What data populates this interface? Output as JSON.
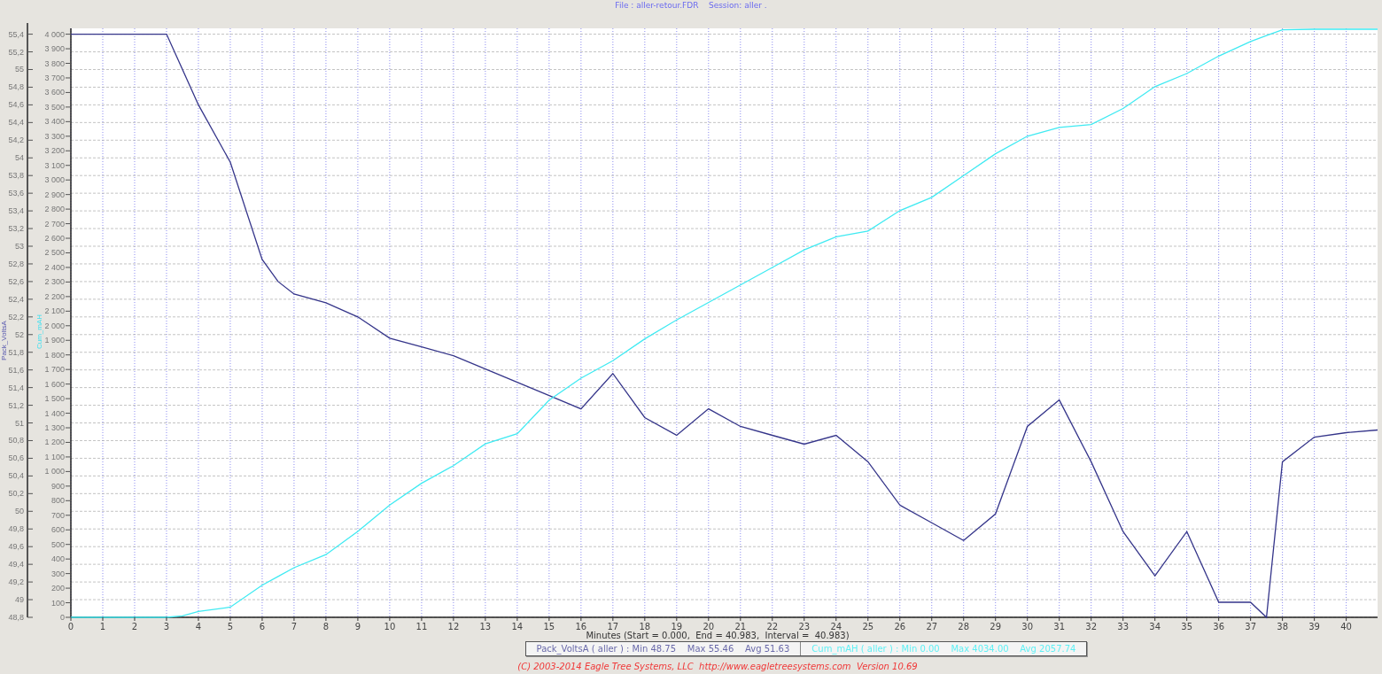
{
  "window": {
    "title": "File : aller-retour.FDR    Session: aller ."
  },
  "chart": {
    "chart_data": {
      "type": "line",
      "xlabel": "Minutes (Start = 0.000,  End = 40.983,  Interval =  40.983)",
      "ylabel": "Pack_VoltsA",
      "y2label": "Cum_mAH",
      "x": [
        0,
        1,
        2,
        3,
        3.5,
        4,
        5,
        6,
        6.5,
        7,
        8,
        9,
        10,
        11,
        12,
        13,
        14,
        15,
        16,
        17,
        18,
        19,
        20,
        21,
        22,
        23,
        24,
        25,
        26,
        27,
        28,
        29,
        30,
        31,
        32,
        33,
        34,
        35,
        36,
        37,
        37.5,
        38,
        39,
        40,
        40.983
      ],
      "series": [
        {
          "name": "Pack_VoltsA ( aller )",
          "color": "#35358a",
          "values": [
            55.4,
            55.4,
            55.4,
            55.4,
            55.0,
            54.6,
            53.95,
            52.85,
            52.6,
            52.46,
            52.36,
            52.2,
            51.96,
            51.86,
            51.76,
            51.61,
            51.46,
            51.31,
            51.16,
            51.56,
            51.06,
            50.86,
            51.16,
            50.96,
            50.86,
            50.76,
            50.86,
            50.56,
            50.07,
            49.87,
            49.67,
            49.97,
            50.96,
            51.26,
            50.56,
            49.77,
            49.27,
            49.77,
            48.97,
            48.97,
            48.8,
            50.56,
            50.84,
            50.89,
            50.92
          ]
        },
        {
          "name": "Cum_mAH ( aller )",
          "color": "#40eaf2",
          "axis": "y2",
          "values": [
            0,
            0,
            0,
            0,
            10,
            40,
            70,
            220,
            280,
            340,
            430,
            590,
            770,
            920,
            1040,
            1190,
            1260,
            1490,
            1640,
            1760,
            1910,
            2040,
            2160,
            2280,
            2400,
            2520,
            2610,
            2650,
            2790,
            2880,
            3030,
            3180,
            3300,
            3360,
            3380,
            3490,
            3640,
            3730,
            3850,
            3950,
            3990,
            4030,
            4034,
            4034,
            4034
          ]
        }
      ],
      "xlim": [
        0,
        40.983
      ],
      "ylim": [
        48.8,
        55.466
      ],
      "y2lim": [
        0,
        4040
      ],
      "grid": true,
      "xticks": [
        0,
        1,
        2,
        3,
        4,
        5,
        6,
        7,
        8,
        9,
        10,
        11,
        12,
        13,
        14,
        15,
        16,
        17,
        18,
        19,
        20,
        21,
        22,
        23,
        24,
        25,
        26,
        27,
        28,
        29,
        30,
        31,
        32,
        33,
        34,
        35,
        36,
        37,
        38,
        39,
        40
      ],
      "yticks": [
        {
          "value": 48.8,
          "label": "48,8"
        },
        {
          "value": 49,
          "label": "49"
        },
        {
          "value": 49.2,
          "label": "49,2"
        },
        {
          "value": 49.4,
          "label": "49,4"
        },
        {
          "value": 49.6,
          "label": "49,6"
        },
        {
          "value": 49.8,
          "label": "49,8"
        },
        {
          "value": 50,
          "label": "50"
        },
        {
          "value": 50.2,
          "label": "50,2"
        },
        {
          "value": 50.4,
          "label": "50,4"
        },
        {
          "value": 50.6,
          "label": "50,6"
        },
        {
          "value": 50.8,
          "label": "50,8"
        },
        {
          "value": 51,
          "label": "51"
        },
        {
          "value": 51.2,
          "label": "51,2"
        },
        {
          "value": 51.4,
          "label": "51,4"
        },
        {
          "value": 51.6,
          "label": "51,6"
        },
        {
          "value": 51.8,
          "label": "51,8"
        },
        {
          "value": 52,
          "label": "52"
        },
        {
          "value": 52.2,
          "label": "52,2"
        },
        {
          "value": 52.4,
          "label": "52,4"
        },
        {
          "value": 52.6,
          "label": "52,6"
        },
        {
          "value": 52.8,
          "label": "52,8"
        },
        {
          "value": 53,
          "label": "53"
        },
        {
          "value": 53.2,
          "label": "53,2"
        },
        {
          "value": 53.4,
          "label": "53,4"
        },
        {
          "value": 53.6,
          "label": "53,6"
        },
        {
          "value": 53.8,
          "label": "53,8"
        },
        {
          "value": 54,
          "label": "54"
        },
        {
          "value": 54.2,
          "label": "54,2"
        },
        {
          "value": 54.4,
          "label": "54,4"
        },
        {
          "value": 54.6,
          "label": "54,6"
        },
        {
          "value": 54.8,
          "label": "54,8"
        },
        {
          "value": 55,
          "label": "55"
        },
        {
          "value": 55.2,
          "label": "55,2"
        },
        {
          "value": 55.4,
          "label": "55,4"
        }
      ],
      "y2ticks": [
        {
          "value": 0,
          "label": "0"
        },
        {
          "value": 100,
          "label": "100"
        },
        {
          "value": 200,
          "label": "200"
        },
        {
          "value": 300,
          "label": "300"
        },
        {
          "value": 400,
          "label": "400"
        },
        {
          "value": 500,
          "label": "500"
        },
        {
          "value": 600,
          "label": "600"
        },
        {
          "value": 700,
          "label": "700"
        },
        {
          "value": 800,
          "label": "800"
        },
        {
          "value": 900,
          "label": "900"
        },
        {
          "value": 1000,
          "label": "1 000"
        },
        {
          "value": 1100,
          "label": "1 100"
        },
        {
          "value": 1200,
          "label": "1 200"
        },
        {
          "value": 1300,
          "label": "1 300"
        },
        {
          "value": 1400,
          "label": "1 400"
        },
        {
          "value": 1500,
          "label": "1 500"
        },
        {
          "value": 1600,
          "label": "1 600"
        },
        {
          "value": 1700,
          "label": "1 700"
        },
        {
          "value": 1800,
          "label": "1 800"
        },
        {
          "value": 1900,
          "label": "1 900"
        },
        {
          "value": 2000,
          "label": "2 000"
        },
        {
          "value": 2100,
          "label": "2 100"
        },
        {
          "value": 2200,
          "label": "2 200"
        },
        {
          "value": 2300,
          "label": "2 300"
        },
        {
          "value": 2400,
          "label": "2 400"
        },
        {
          "value": 2500,
          "label": "2 500"
        },
        {
          "value": 2600,
          "label": "2 600"
        },
        {
          "value": 2700,
          "label": "2 700"
        },
        {
          "value": 2800,
          "label": "2 800"
        },
        {
          "value": 2900,
          "label": "2 900"
        },
        {
          "value": 3000,
          "label": "3 000"
        },
        {
          "value": 3100,
          "label": "3 100"
        },
        {
          "value": 3200,
          "label": "3 200"
        },
        {
          "value": 3300,
          "label": "3 300"
        },
        {
          "value": 3400,
          "label": "3 400"
        },
        {
          "value": 3500,
          "label": "3 500"
        },
        {
          "value": 3600,
          "label": "3 600"
        },
        {
          "value": 3700,
          "label": "3 700"
        },
        {
          "value": 3800,
          "label": "3 800"
        },
        {
          "value": 3900,
          "label": "3 900"
        },
        {
          "value": 4000,
          "label": "4 000"
        }
      ]
    }
  },
  "legend": [
    {
      "text": ": Min 48.75    Max 55.46    Avg 51.63",
      "color": "#6a6aaa"
    },
    {
      "text": ": Min 0.00    Max 4034.00    Avg 2057.74",
      "color": "#5ff0f5"
    }
  ],
  "footer": "(C) 2003-2014 Eagle Tree Systems, LLC  http://www.eagletreesystems.com  Version 10.69"
}
